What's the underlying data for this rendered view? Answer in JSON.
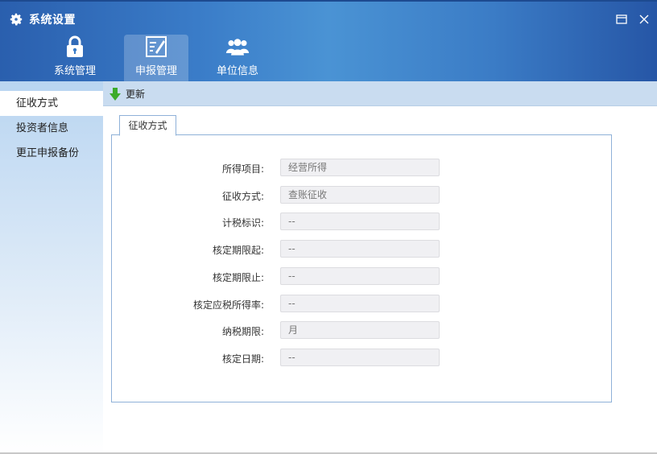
{
  "window": {
    "title": "系统设置"
  },
  "nav": {
    "tabs": [
      {
        "label": "系统管理",
        "icon": "lock-icon"
      },
      {
        "label": "申报管理",
        "icon": "edit-document-icon",
        "active": true
      },
      {
        "label": "单位信息",
        "icon": "users-icon"
      }
    ]
  },
  "sidebar": {
    "items": [
      {
        "label": "征收方式",
        "active": true
      },
      {
        "label": "投资者信息"
      },
      {
        "label": "更正申报备份"
      }
    ]
  },
  "toolbar": {
    "update_label": "更新"
  },
  "content": {
    "tab_label": "征收方式",
    "fields": [
      {
        "label": "所得项目:",
        "value": "经营所得"
      },
      {
        "label": "征收方式:",
        "value": "查账征收"
      },
      {
        "label": "计税标识:",
        "value": "--"
      },
      {
        "label": "核定期限起:",
        "value": "--"
      },
      {
        "label": "核定期限止:",
        "value": "--"
      },
      {
        "label": "核定应税所得率:",
        "value": "--"
      },
      {
        "label": "纳税期限:",
        "value": "月"
      },
      {
        "label": "核定日期:",
        "value": "--"
      }
    ]
  },
  "colors": {
    "header_blue": "#3a7cc8",
    "toolbar_bg": "#c9dcf0",
    "accent_green": "#3cab2a"
  }
}
